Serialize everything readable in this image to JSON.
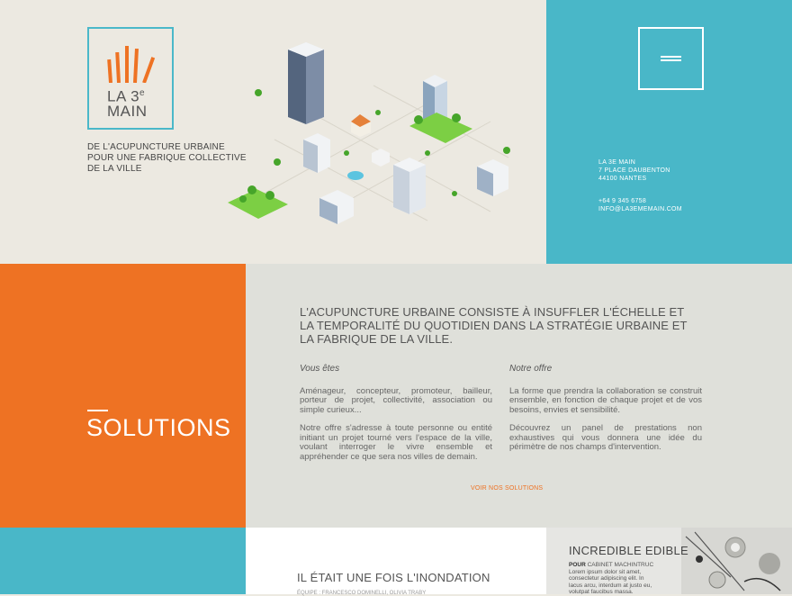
{
  "brand": {
    "logo_line1": "LA 3",
    "logo_sup": "e",
    "logo_line2": "MAIN",
    "tagline": "DE L'ACUPUNCTURE URBAINE POUR UNE FABRIQUE COLLECTIVE DE LA VILLE"
  },
  "contact": {
    "name": "LA 3E MAIN",
    "street": "7 PLACE DAUBENTON",
    "city": "44100 NANTES",
    "phone": "+64 9 345 6758",
    "email": "INFO@LA3EMEMAIN.COM"
  },
  "solutions": {
    "title": "SOLUTIONS",
    "lead": "L'ACUPUNCTURE URBAINE CONSISTE À INSUFFLER L'ÉCHELLE ET LA TEMPORALITÉ DU QUOTIDIEN DANS LA STRATÉGIE URBAINE ET LA FABRIQUE DE LA VILLE.",
    "col1_heading": "Vous êtes",
    "col1_p1": "Aménageur, concepteur, promoteur, bailleur, porteur de projet, collectivité, association ou simple curieux...",
    "col1_p2": "Notre offre s'adresse à toute personne ou entité initiant un projet tourné vers l'espace de la ville, voulant interroger le vivre ensemble et appréhender ce que sera nos villes de demain.",
    "col2_heading": "Notre offre",
    "col2_p1": "La forme que prendra la collaboration se construit ensemble, en fonction de chaque projet et de vos besoins, envies et sensibilité.",
    "col2_p2": "Découvrez un panel de prestations non exhaustives qui vous donnera une idée du périmètre de nos champs d'intervention.",
    "cta": "VOIR NOS SOLUTIONS"
  },
  "projects": {
    "story_title": "IL ÉTAIT UNE FOIS L'INONDATION",
    "story_sub": "ÉQUIPE : FRANCESCO DOMINELLI, OLIVIA TRABY",
    "edible_title": "INCREDIBLE EDIBLE",
    "edible_pour": "POUR",
    "edible_client": "CABINET MACHINTRUC",
    "edible_text": "Lorem ipsum dolor sit amet, consectetur adipiscing elit. In lacus arcu, interdum at justo eu, volutpat faucibus massa."
  },
  "colors": {
    "teal": "#49b7c8",
    "orange": "#ee7223",
    "beige": "#ece9e1",
    "gray": "#dfe0da"
  }
}
